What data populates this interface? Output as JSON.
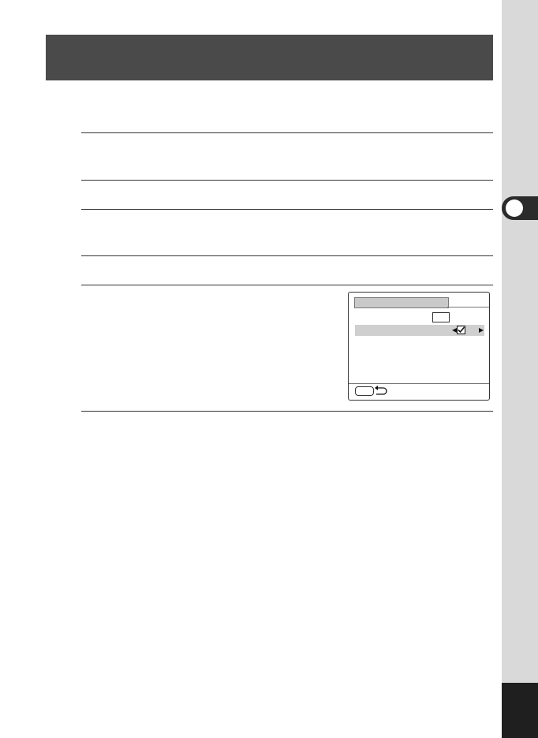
{
  "page": {
    "title": "",
    "colors": {
      "title_bar": "#4a4a4a",
      "side_strip": "#d9d9d9",
      "chapter_tab": "#2b2b2b",
      "page_block": "#1f1f1f"
    }
  },
  "chapter_marker": {
    "icon": "chapter-circle-icon"
  },
  "screen": {
    "icons": {
      "left": "triangle-left-icon",
      "check": "checkbox-checked-icon",
      "right": "triangle-right-icon",
      "menu": "menu-button-icon",
      "back": "return-arrow-icon"
    },
    "glyphs": {
      "left_arrow": "◀",
      "right_arrow": "▶"
    }
  }
}
